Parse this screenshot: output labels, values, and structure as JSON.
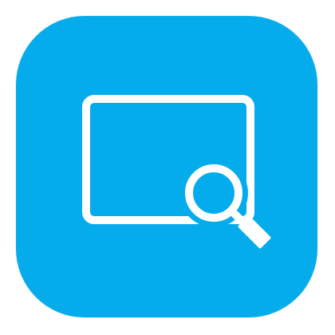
{
  "app_icon": {
    "icon_name": "screen-search-icon",
    "background_color": "#05ACEB",
    "glyph_color": "#FFFFFF"
  }
}
